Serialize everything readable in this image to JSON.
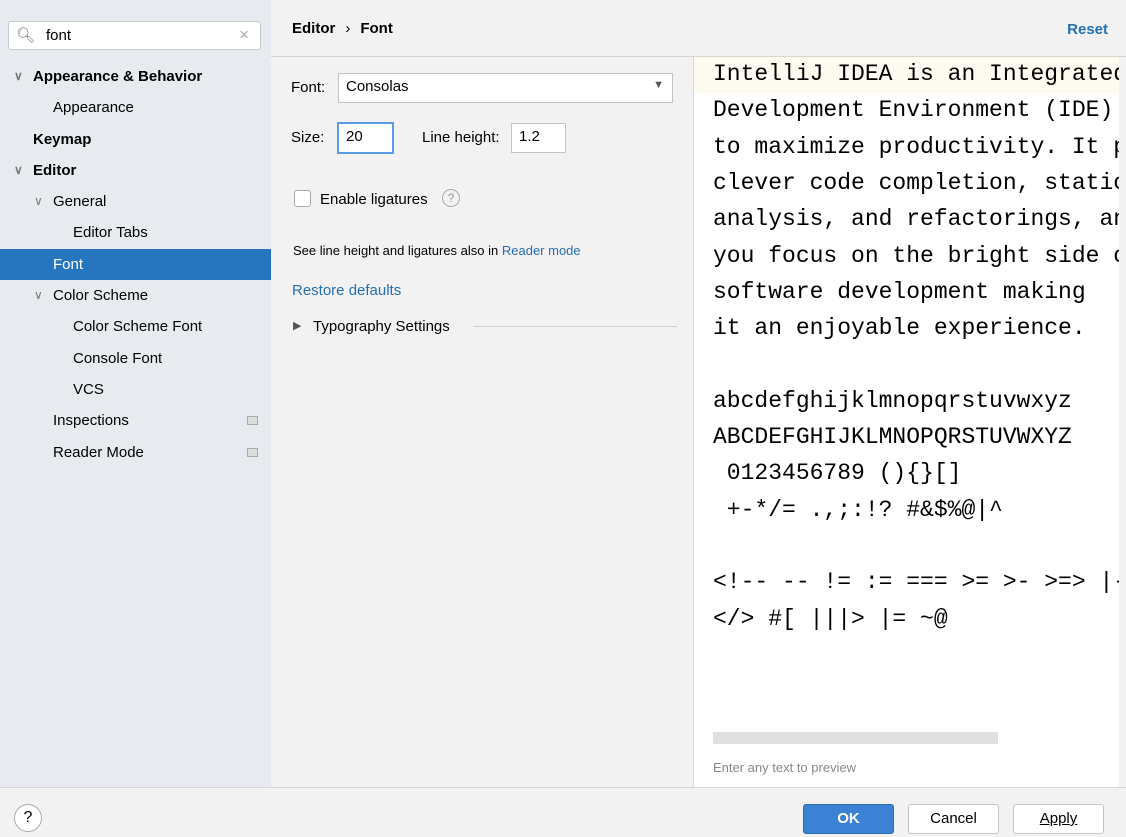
{
  "search": {
    "value": "font"
  },
  "tree": [
    {
      "label": "Appearance & Behavior",
      "level": 0,
      "bold": true,
      "chevron": true
    },
    {
      "label": "Appearance",
      "level": 1
    },
    {
      "label": "Keymap",
      "level": 0,
      "bold": true
    },
    {
      "label": "Editor",
      "level": 0,
      "bold": true,
      "chevron": true
    },
    {
      "label": "General",
      "level": 1,
      "chevron": true
    },
    {
      "label": "Editor Tabs",
      "level": 2
    },
    {
      "label": "Font",
      "level": 1,
      "selected": true
    },
    {
      "label": "Color Scheme",
      "level": 1,
      "chevron": true
    },
    {
      "label": "Color Scheme Font",
      "level": 2
    },
    {
      "label": "Console Font",
      "level": 2
    },
    {
      "label": "VCS",
      "level": 2
    },
    {
      "label": "Inspections",
      "level": 1,
      "tag": true
    },
    {
      "label": "Reader Mode",
      "level": 1,
      "tag": true
    }
  ],
  "header": {
    "crumb1": "Editor",
    "sep": "›",
    "crumb2": "Font",
    "reset": "Reset"
  },
  "form": {
    "font_label": "Font:",
    "font_value": "Consolas",
    "size_label": "Size:",
    "size_value": "20",
    "lh_label": "Line height:",
    "lh_value": "1.2",
    "ligatures_label": "Enable ligatures",
    "ligatures_checked": false,
    "note": "See line height and ligatures also in ",
    "note_link": "Reader mode",
    "restore": "Restore defaults",
    "typography": "Typography Settings"
  },
  "preview": {
    "lines": [
      "IntelliJ IDEA is an Integrated",
      "Development Environment (IDE) designed",
      "to maximize productivity. It provides",
      "clever code completion, static code",
      "analysis, and refactorings, and lets",
      "you focus on the bright side of",
      "software development making",
      "it an enjoyable experience.",
      "",
      "abcdefghijklmnopqrstuvwxyz",
      "ABCDEFGHIJKLMNOPQRSTUVWXYZ",
      " 0123456789 (){}[]",
      " +-*/= .,;:!? #&$%@|^",
      "",
      "<!-- -- != := === >= >- >=> |-> ->",
      "</> #[ |||> |= ~@"
    ],
    "placeholder": "Enter any text to preview"
  },
  "buttons": {
    "help": "?",
    "ok": "OK",
    "cancel": "Cancel",
    "apply": "Apply"
  },
  "colors": {
    "accent": "#2675bf",
    "link": "#2470b3"
  }
}
